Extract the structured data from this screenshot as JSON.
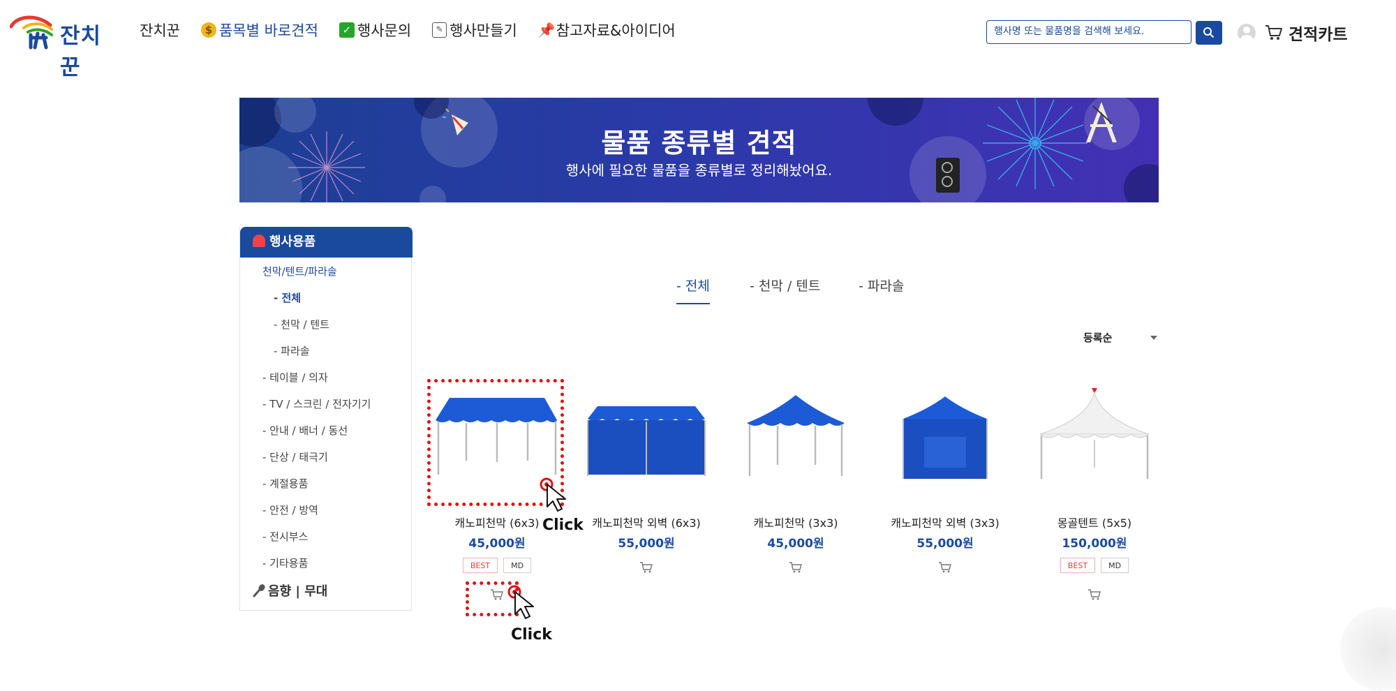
{
  "header": {
    "logo_text": "잔치꾼",
    "nav": [
      {
        "label": "잔치꾼",
        "icon": ""
      },
      {
        "label": "품목별 바로견적",
        "icon": "money-bag-icon"
      },
      {
        "label": "행사문의",
        "icon": "check-icon"
      },
      {
        "label": "행사만들기",
        "icon": "memo-icon"
      },
      {
        "label": "참고자료&아이디어",
        "icon": "pushpin-icon"
      }
    ],
    "search_placeholder": "행사명 또는 물품명을 검색해 보세요.",
    "cart_label": "견적카트"
  },
  "banner": {
    "title": "물품 종류별 견적",
    "subtitle": "행사에 필요한 물품을 종류별로 정리해놨어요."
  },
  "sidebar": {
    "heading": "행사용품",
    "items": [
      {
        "label": "천막/텐트/파라솔"
      },
      {
        "label": "- 전체"
      },
      {
        "label": "- 천막 / 텐트"
      },
      {
        "label": "- 파라솔"
      },
      {
        "label": "- 테이블 / 의자"
      },
      {
        "label": "- TV / 스크린 / 전자기기"
      },
      {
        "label": "- 안내 / 배너 / 동선"
      },
      {
        "label": "- 단상 / 태극기"
      },
      {
        "label": "- 계절용품"
      },
      {
        "label": "- 안전 / 방역"
      },
      {
        "label": "- 전시부스"
      },
      {
        "label": "- 기타용품"
      }
    ],
    "audio_heading": "음향 | 무대"
  },
  "tabs": [
    {
      "label": "- 전체",
      "active": true
    },
    {
      "label": "- 천막 / 텐트",
      "active": false
    },
    {
      "label": "- 파라솔",
      "active": false
    }
  ],
  "sort_label": "등록순",
  "products": [
    {
      "name": "캐노피천막 (6x3)",
      "price": "45,000원",
      "badges": [
        "BEST",
        "MD"
      ]
    },
    {
      "name": "캐노피천막 외벽 (6x3)",
      "price": "55,000원",
      "badges": []
    },
    {
      "name": "캐노피천막 (3x3)",
      "price": "45,000원",
      "badges": []
    },
    {
      "name": "캐노피천막 외벽 (3x3)",
      "price": "55,000원",
      "badges": []
    },
    {
      "name": "몽골텐트 (5x5)",
      "price": "150,000원",
      "badges": [
        "BEST",
        "MD"
      ]
    }
  ],
  "annotations": {
    "click_label_1": "Click",
    "click_label_2": "Click",
    "color": "#e01010"
  },
  "colors": {
    "brand_blue": "#1a4a9e",
    "best_red": "#e53935"
  }
}
